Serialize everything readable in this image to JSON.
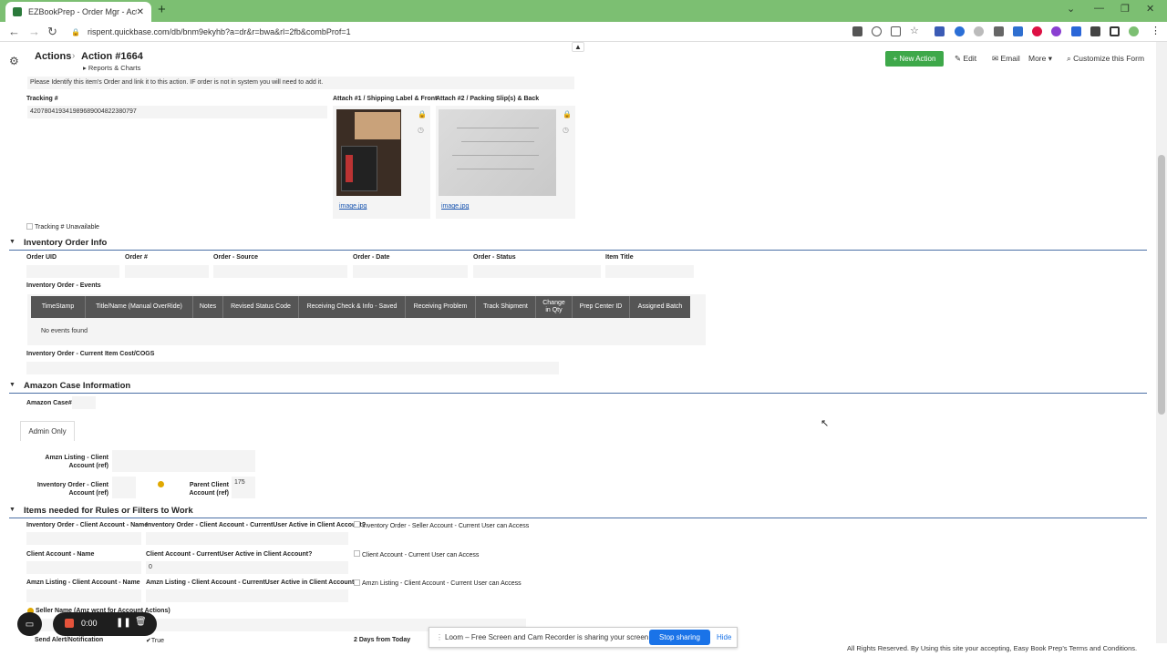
{
  "browser": {
    "tab_title": "EZBookPrep - Order Mgr - Action",
    "tab_close": "✕",
    "new_tab": "+",
    "url": "rispent.quickbase.com/db/bnm9ekyhb?a=dr&r=bwa&rl=2fb&combProf=1"
  },
  "header": {
    "breadcrumb_table": "Actions",
    "breadcrumb_record": "Action #1664",
    "reports_link": "Reports & Charts",
    "new_action": "+ New Action",
    "edit": "Edit",
    "email": "Email",
    "more": "More",
    "customize": "Customize this Form"
  },
  "top": {
    "identify_note": "Please Identify this item's Order and link it to this action. IF order is not in system you will need to add it.",
    "tracking_label": "Tracking #",
    "tracking_value": "420780419341989689004822380797",
    "attach1_label": "Attach #1 / Shipping Label & Front",
    "attach2_label": "Attach #2 / Packing Slip(s) & Back",
    "attach1_link": "image.jpg",
    "attach2_link": "image.jpg",
    "tracking_unavailable": "Tracking # Unavailable"
  },
  "inventory": {
    "title": "Inventory Order Info",
    "fields": [
      "Order UID",
      "Order #",
      "Order - Source",
      "Order - Date",
      "Order - Status",
      "Item Title"
    ],
    "events_label": "Inventory Order - Events",
    "events_columns": [
      "TimeStamp",
      "Title/Name (Manual OverRide)",
      "Notes",
      "Revised Status Code",
      "Receiving Check & Info - Saved",
      "Receiving Problem",
      "Track Shipment",
      "Change in Qty",
      "Prep Center ID",
      "Assigned Batch"
    ],
    "no_events": "No events found",
    "cost_label": "Inventory Order - Current Item Cost/COGS"
  },
  "amazon": {
    "title": "Amazon Case Information",
    "case_label": "Amazon Case#",
    "admin_tab": "Admin Only",
    "amzn_listing_label": "Amzn Listing - Client Account (ref)",
    "inv_client_label": "Inventory Order - Client Account (ref)",
    "parent_client_label": "Parent Client Account (ref)",
    "parent_client_value": "175"
  },
  "rules": {
    "title": "Items needed for Rules or Filters to Work",
    "r1c1": "Inventory Order - Client Account - Name",
    "r1c2": "Inventory Order - Client Account - CurrentUser Active in Client Account?",
    "r1c3": "Inventory Order - Seller Account - Current User can Access",
    "r2c1": "Client Account - Name",
    "r2c2": "Client Account - CurrentUser Active in Client Account?",
    "r2c2_value": "0",
    "r2c3": "Client Account - Current User can Access",
    "r3c1": "Amzn Listing - Client Account - Name",
    "r3c2": "Amzn Listing - Client Account - CurrentUser Active in Client Account?",
    "r3c3": "Amzn Listing - Client Account - Current User can Access",
    "r4c1": "Seller Name (Amz wcnt for Account Actions)",
    "r5c1": "Send Alert/Notification",
    "r5c2": "True",
    "r5c3": "2 Days from Today"
  },
  "loom": {
    "time": "0:00",
    "share_text": "Loom – Free Screen and Cam Recorder is sharing your screen.",
    "stop_sharing": "Stop sharing",
    "hide": "Hide"
  },
  "footer": "All Rights Reserved. By Using this site your accepting, Easy Book Prep's Terms and Conditions.",
  "colors": {
    "tab_bar": "#7cbf72",
    "new_action": "#3ea84a",
    "section_rule": "#4a6fa5",
    "link": "#1a56b0"
  }
}
